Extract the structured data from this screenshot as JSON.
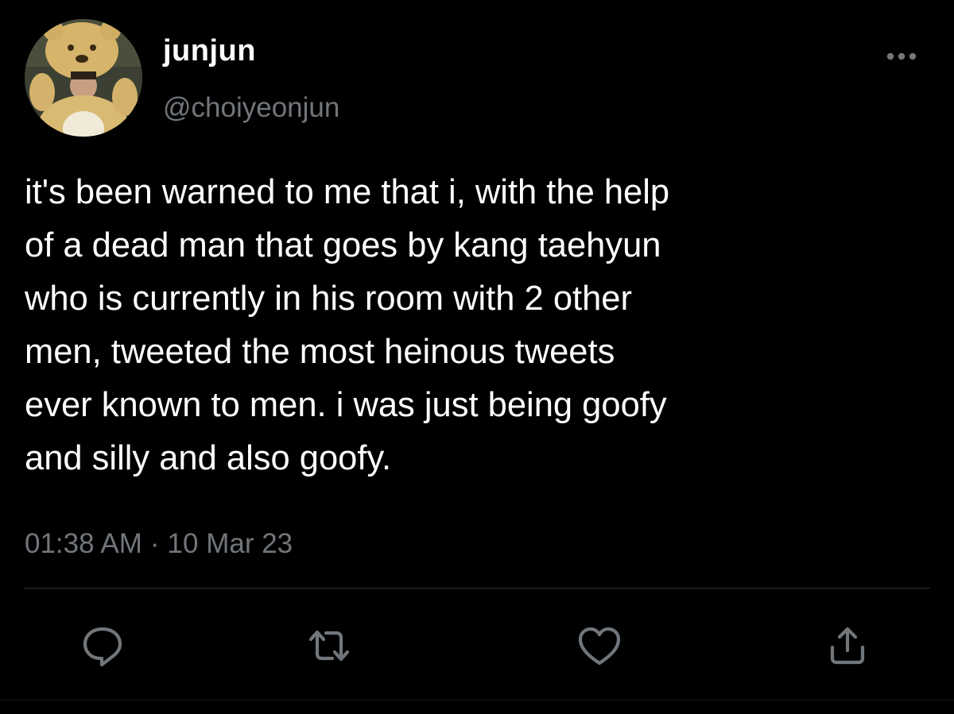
{
  "user": {
    "display_name": "junjun",
    "handle": "@choiyeonjun",
    "avatar_icon": "avatar-photo-bear-costume"
  },
  "tweet": {
    "text": "it's been warned to me that i, with the help\nof a dead man that goes by kang taehyun\nwho is currently in his room with 2 other\nmen, tweeted the most heinous tweets\never known to men. i was just being goofy\nand silly and also goofy.",
    "time": "01:38 AM",
    "separator": "·",
    "date": "10 Mar 23"
  },
  "actions": [
    {
      "name": "reply",
      "icon": "reply-icon"
    },
    {
      "name": "retweet",
      "icon": "retweet-icon"
    },
    {
      "name": "like",
      "icon": "heart-icon"
    },
    {
      "name": "share",
      "icon": "share-icon"
    }
  ],
  "more_icon": "more-horizontal-icon",
  "colors": {
    "background": "#000000",
    "primary_text": "#ffffff",
    "secondary_text": "#71767b",
    "icon": "#71767b",
    "divider": "#2f3336"
  }
}
